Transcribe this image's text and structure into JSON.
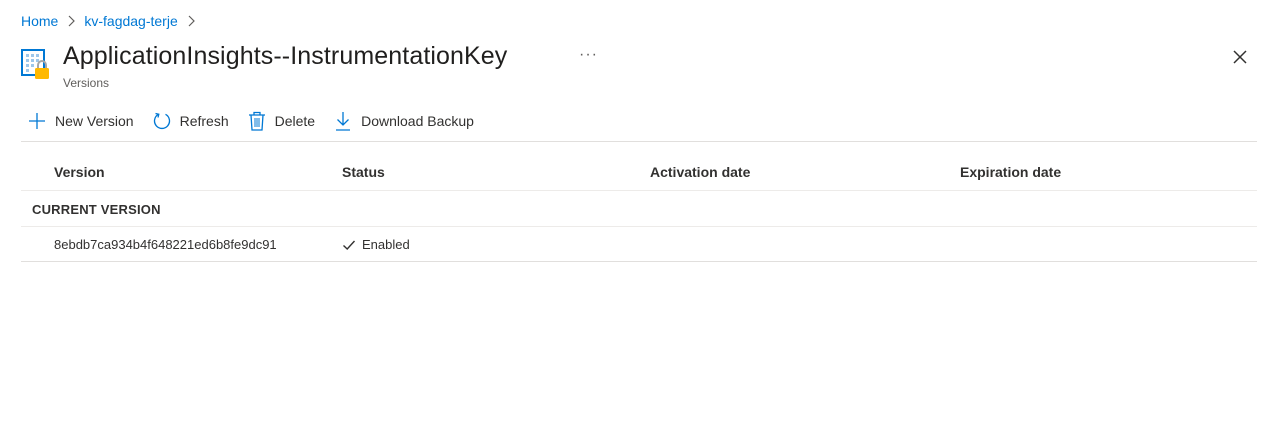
{
  "breadcrumb": {
    "items": [
      "Home",
      "kv-fagdag-terje"
    ]
  },
  "header": {
    "title": "ApplicationInsights--InstrumentationKey",
    "subtitle": "Versions",
    "more": "···"
  },
  "toolbar": {
    "new_version": "New Version",
    "refresh": "Refresh",
    "delete": "Delete",
    "download_backup": "Download Backup"
  },
  "table": {
    "columns": [
      "Version",
      "Status",
      "Activation date",
      "Expiration date"
    ],
    "group_label": "CURRENT VERSION",
    "rows": [
      {
        "version": "8ebdb7ca934b4f648221ed6b8fe9dc91",
        "status": "Enabled",
        "activation_date": "",
        "expiration_date": ""
      }
    ]
  },
  "colors": {
    "accent": "#0078d4",
    "lock": "#ffb900"
  }
}
